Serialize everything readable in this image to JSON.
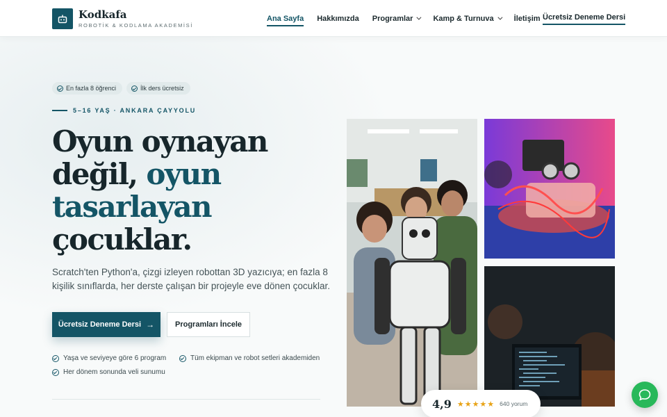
{
  "brand": {
    "name": "Kodkafa",
    "tagline": "ROBOTİK & KODLAMA AKADEMİSİ",
    "logo_icon": "robot-icon",
    "color": "#145566"
  },
  "nav": {
    "items": [
      {
        "label": "Ana Sayfa",
        "active": true
      },
      {
        "label": "Hakkımızda"
      },
      {
        "label": "Programlar",
        "dropdown": true
      },
      {
        "label": "Kamp & Turnuva",
        "dropdown": true
      },
      {
        "label": "İletişim"
      }
    ],
    "cta": "Ücretsiz Deneme Dersi"
  },
  "hero": {
    "badges": [
      "En fazla 8 öğrenci",
      "İlk ders ücretsiz"
    ],
    "eyebrow": "5–16 YAŞ · ANKARA ÇAYYOLU",
    "title_line1": "Oyun oynayan",
    "title_line2a": "değil, ",
    "title_line2b": "oyun",
    "title_line3": "tasarlayan",
    "title_line4": "çocuklar.",
    "lead": "Scratch'ten Python'a, çizgi izleyen robottan 3D yazıcıya; en fazla 8 kişilik sınıflarda, her derste çalışan bir projeyle eve dönen çocuklar.",
    "primary_button": "Ücretsiz Deneme Dersi",
    "secondary_button": "Programları İncele",
    "features": [
      "Yaşa ve seviyeye göre 6 program",
      "Tüm ekipman ve robot setleri akademiden",
      "Her dönem sonunda veli sunumu"
    ]
  },
  "rating": {
    "score": "4,9",
    "stars": "★★★★★",
    "star_count": 5,
    "reviews": "640 yorum",
    "star_color": "#e8a317"
  },
  "chat": {
    "icon": "chat-bubble-icon",
    "color": "#28b85a"
  }
}
